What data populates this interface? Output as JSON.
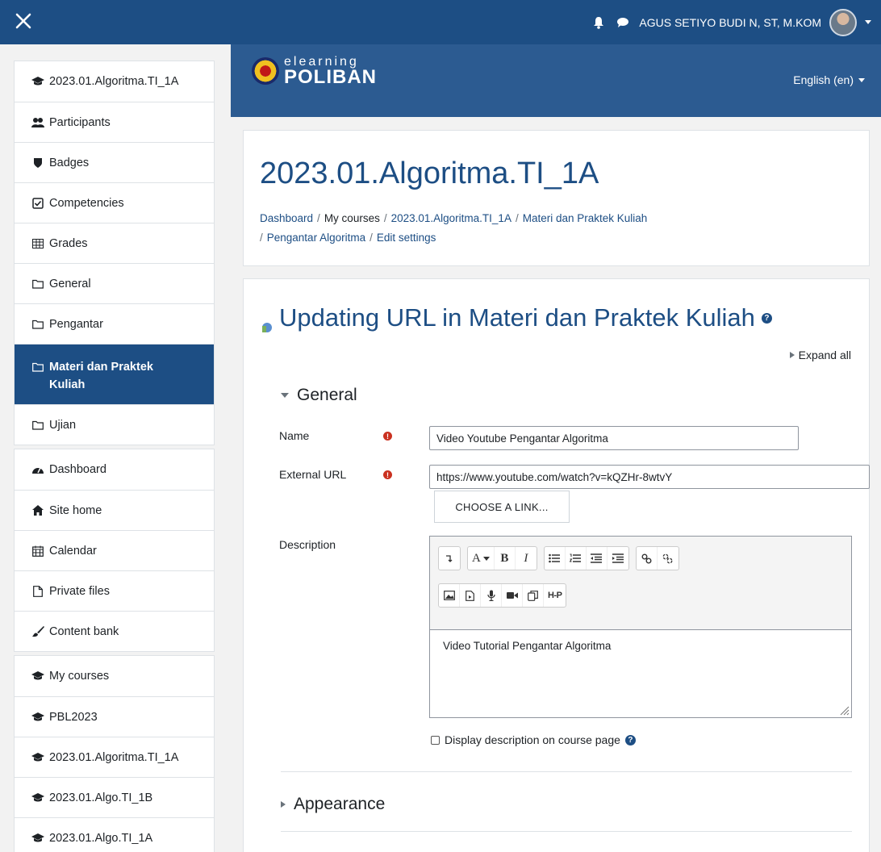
{
  "topbar": {
    "user_name": "AGUS SETIYO BUDI N, ST, M.KOM"
  },
  "sidebar": {
    "course_group": [
      {
        "label": "2023.01.Algoritma.TI_1A",
        "icon": "graduation-cap-icon"
      },
      {
        "label": "Participants",
        "icon": "users-icon"
      },
      {
        "label": "Badges",
        "icon": "shield-icon"
      },
      {
        "label": "Competencies",
        "icon": "check-square-icon"
      },
      {
        "label": "Grades",
        "icon": "table-icon"
      },
      {
        "label": "General",
        "icon": "folder-icon"
      },
      {
        "label": "Pengantar",
        "icon": "folder-icon"
      },
      {
        "label": "Materi dan Praktek Kuliah",
        "icon": "folder-icon",
        "active": true
      },
      {
        "label": "Ujian",
        "icon": "folder-icon"
      }
    ],
    "site_group": [
      {
        "label": "Dashboard",
        "icon": "tachometer-icon"
      },
      {
        "label": "Site home",
        "icon": "home-icon"
      },
      {
        "label": "Calendar",
        "icon": "calendar-icon"
      },
      {
        "label": "Private files",
        "icon": "file-icon"
      },
      {
        "label": "Content bank",
        "icon": "paint-brush-icon"
      }
    ],
    "mycourses_group": [
      {
        "label": "My courses",
        "icon": "graduation-cap-icon"
      },
      {
        "label": "PBL2023",
        "icon": "graduation-cap-icon"
      },
      {
        "label": "2023.01.Algoritma.TI_1A",
        "icon": "graduation-cap-icon"
      },
      {
        "label": "2023.01.Algo.TI_1B",
        "icon": "graduation-cap-icon"
      },
      {
        "label": "2023.01.Algo.TI_1A",
        "icon": "graduation-cap-icon"
      }
    ]
  },
  "banner": {
    "logo_line1": "elearning",
    "logo_line2": "POLIBAN",
    "language": "English (en)"
  },
  "header": {
    "title": "2023.01.Algoritma.TI_1A",
    "breadcrumb": [
      "Dashboard",
      "My courses",
      "2023.01.Algoritma.TI_1A",
      "Materi dan Praktek Kuliah",
      "Pengantar Algoritma",
      "Edit settings"
    ]
  },
  "form": {
    "title": "Updating URL in Materi dan Praktek Kuliah",
    "expand_all": "Expand all",
    "section_general": "General",
    "name_label": "Name",
    "name_value": "Video Youtube Pengantar Algoritma",
    "url_label": "External URL",
    "url_value": "https://www.youtube.com/watch?v=kQZHr-8wtvY",
    "choose_link": "CHOOSE A LINK...",
    "description_label": "Description",
    "description_value": "Video Tutorial Pengantar Algoritma",
    "display_desc_label": "Display description on course page",
    "section_appearance": "Appearance"
  },
  "editor_toolbar": {
    "bold": "B",
    "italic": "I",
    "font": "A",
    "h5p": "H-P"
  },
  "colors": {
    "navbar": "#1d4e84",
    "banner": "#2c5b91",
    "link": "#1d4e84",
    "required": "#ca3120"
  }
}
